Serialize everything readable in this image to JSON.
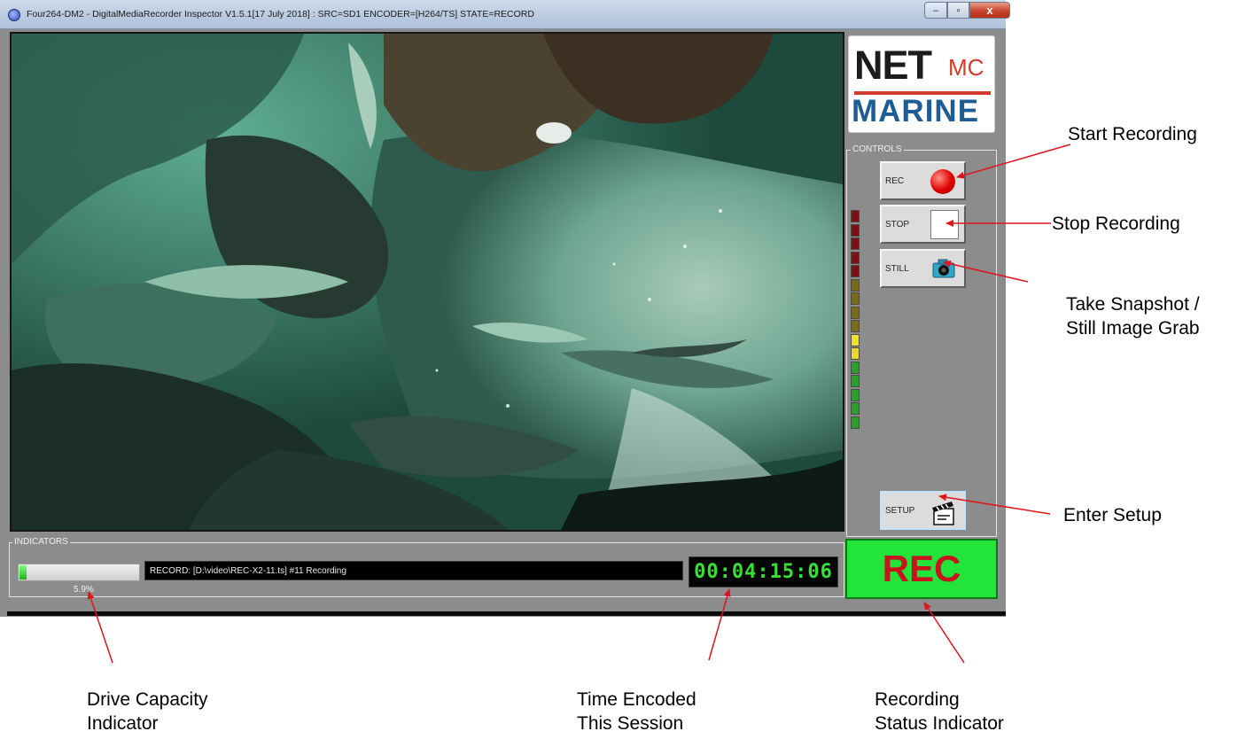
{
  "window": {
    "title": "Four264-DM2 - DigitalMediaRecorder Inspector  V1.5.1[17 July 2018] : SRC=SD1 ENCODER=[H264/TS] STATE=RECORD",
    "minimize_glyph": "‒",
    "maximize_glyph": "▫",
    "close_glyph": "x"
  },
  "logo": {
    "net": "NET",
    "mc": "MC",
    "marine": "MARINE"
  },
  "controls": {
    "group_label": "CONTROLS",
    "rec_label": "REC",
    "stop_label": "STOP",
    "still_label": "STILL",
    "setup_label": "SETUP"
  },
  "level_meter": {
    "colors": [
      "#7a1414",
      "#7a1414",
      "#7a1414",
      "#7a1414",
      "#7a1414",
      "#7a6a1e",
      "#7a6a1e",
      "#7a6a1e",
      "#7a6a1e",
      "#f2dc3a",
      "#e9d53a",
      "#2e9e2e",
      "#2e9e2e",
      "#2e9e2e",
      "#2e9e2e",
      "#2e9e2e"
    ]
  },
  "indicators": {
    "group_label": "INDICATORS",
    "drive_capacity_fraction": 0.059,
    "drive_percent_text": "5.9%",
    "status_text": "RECORD: [D:\\video\\REC-X2-11.ts] #11 Recording",
    "timecode": "00:04:15:06",
    "record_state": "REC"
  },
  "annotations": {
    "start_recording": "Start Recording",
    "stop_recording": "Stop Recording",
    "snapshot_line1": "Take Snapshot /",
    "snapshot_line2": "Still Image Grab",
    "enter_setup": "Enter Setup",
    "drive_line1": "Drive Capacity",
    "drive_line2": "Indicator",
    "time_line1": "Time Encoded",
    "time_line2": "This Session",
    "status_line1": "Recording",
    "status_line2": "Status Indicator"
  },
  "colors": {
    "window_bg": "#8c8c8c",
    "rec_indicator_bg": "#22e43a",
    "rec_indicator_text": "#c8151d",
    "timecode_text": "#34e134",
    "arrow": "#e0141c"
  }
}
